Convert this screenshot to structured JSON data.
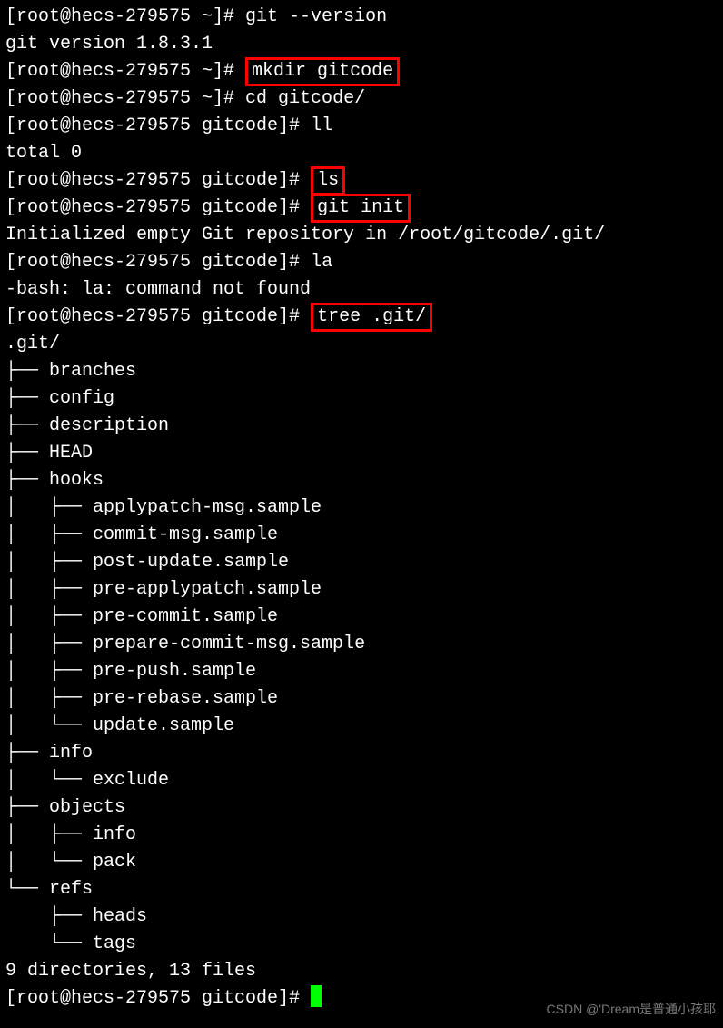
{
  "lines": [
    {
      "type": "prompt",
      "user": "root",
      "host": "hecs-279575",
      "path": "~",
      "cmd_pre": "git --version",
      "cmd_hl": "",
      "cmd_post": "",
      "highlight": false
    },
    {
      "type": "output",
      "text": "git version 1.8.3.1"
    },
    {
      "type": "prompt",
      "user": "root",
      "host": "hecs-279575",
      "path": "~",
      "cmd_pre": "",
      "cmd_hl": "mkdir gitcode",
      "cmd_post": "",
      "highlight": true
    },
    {
      "type": "prompt",
      "user": "root",
      "host": "hecs-279575",
      "path": "~",
      "cmd_pre": "cd gitcode/",
      "cmd_hl": "",
      "cmd_post": "",
      "highlight": false
    },
    {
      "type": "prompt",
      "user": "root",
      "host": "hecs-279575",
      "path": "gitcode",
      "cmd_pre": "ll",
      "cmd_hl": "",
      "cmd_post": "",
      "highlight": false
    },
    {
      "type": "output",
      "text": "total 0"
    },
    {
      "type": "prompt",
      "user": "root",
      "host": "hecs-279575",
      "path": "gitcode",
      "cmd_pre": "",
      "cmd_hl": "ls",
      "cmd_post": "",
      "highlight": true
    },
    {
      "type": "prompt",
      "user": "root",
      "host": "hecs-279575",
      "path": "gitcode",
      "cmd_pre": "",
      "cmd_hl": "git init",
      "cmd_post": "",
      "highlight": true
    },
    {
      "type": "output",
      "text": "Initialized empty Git repository in /root/gitcode/.git/"
    },
    {
      "type": "prompt",
      "user": "root",
      "host": "hecs-279575",
      "path": "gitcode",
      "cmd_pre": "la",
      "cmd_hl": "",
      "cmd_post": "",
      "highlight": false
    },
    {
      "type": "output",
      "text": "-bash: la: command not found"
    },
    {
      "type": "prompt",
      "user": "root",
      "host": "hecs-279575",
      "path": "gitcode",
      "cmd_pre": "",
      "cmd_hl": "tree .git/",
      "cmd_post": "",
      "highlight": true
    },
    {
      "type": "output",
      "text": ".git/"
    },
    {
      "type": "output",
      "text": "├── branches"
    },
    {
      "type": "output",
      "text": "├── config"
    },
    {
      "type": "output",
      "text": "├── description"
    },
    {
      "type": "output",
      "text": "├── HEAD"
    },
    {
      "type": "output",
      "text": "├── hooks"
    },
    {
      "type": "output",
      "text": "│   ├── applypatch-msg.sample"
    },
    {
      "type": "output",
      "text": "│   ├── commit-msg.sample"
    },
    {
      "type": "output",
      "text": "│   ├── post-update.sample"
    },
    {
      "type": "output",
      "text": "│   ├── pre-applypatch.sample"
    },
    {
      "type": "output",
      "text": "│   ├── pre-commit.sample"
    },
    {
      "type": "output",
      "text": "│   ├── prepare-commit-msg.sample"
    },
    {
      "type": "output",
      "text": "│   ├── pre-push.sample"
    },
    {
      "type": "output",
      "text": "│   ├── pre-rebase.sample"
    },
    {
      "type": "output",
      "text": "│   └── update.sample"
    },
    {
      "type": "output",
      "text": "├── info"
    },
    {
      "type": "output",
      "text": "│   └── exclude"
    },
    {
      "type": "output",
      "text": "├── objects"
    },
    {
      "type": "output",
      "text": "│   ├── info"
    },
    {
      "type": "output",
      "text": "│   └── pack"
    },
    {
      "type": "output",
      "text": "└── refs"
    },
    {
      "type": "output",
      "text": "    ├── heads"
    },
    {
      "type": "output",
      "text": "    └── tags"
    },
    {
      "type": "output",
      "text": ""
    },
    {
      "type": "output",
      "text": "9 directories, 13 files"
    },
    {
      "type": "prompt-cursor",
      "user": "root",
      "host": "hecs-279575",
      "path": "gitcode"
    }
  ],
  "watermark": "CSDN @'Dream是普通小孩耶"
}
